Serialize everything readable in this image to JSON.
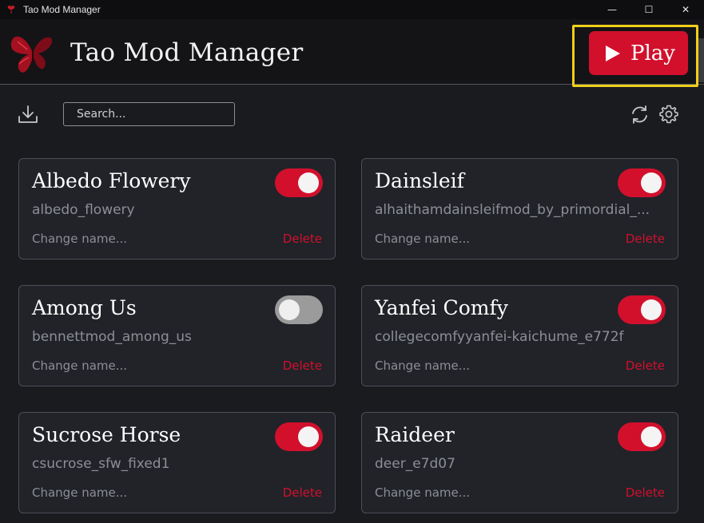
{
  "window": {
    "title": "Tao Mod Manager",
    "controls": {
      "minimize": "—",
      "maximize": "☐",
      "close": "✕"
    }
  },
  "header": {
    "title": "Tao Mod Manager",
    "play_label": "Play"
  },
  "toolbar": {
    "search_placeholder": "Search..."
  },
  "colors": {
    "accent": "#d2102c",
    "background": "#1a1b1f",
    "card": "#212329",
    "highlight": "#f0cf19"
  },
  "icons": {
    "download": "download-icon",
    "refresh": "refresh-icon",
    "settings": "gear-icon",
    "play": "play-icon",
    "logo": "butterfly-logo-icon"
  },
  "mods": [
    {
      "name": "Albedo Flowery",
      "folder": "albedo_flowery",
      "enabled": true,
      "rename_label": "Change name...",
      "delete_label": "Delete"
    },
    {
      "name": "Dainsleif",
      "folder": "alhaithamdainsleifmod_by_primordial_...",
      "enabled": true,
      "rename_label": "Change name...",
      "delete_label": "Delete"
    },
    {
      "name": "Among Us",
      "folder": "bennettmod_among_us",
      "enabled": false,
      "rename_label": "Change name...",
      "delete_label": "Delete"
    },
    {
      "name": "Yanfei Comfy",
      "folder": "collegecomfyyanfei-kaichume_e772f",
      "enabled": true,
      "rename_label": "Change name...",
      "delete_label": "Delete"
    },
    {
      "name": "Sucrose Horse",
      "folder": "csucrose_sfw_fixed1",
      "enabled": true,
      "rename_label": "Change name...",
      "delete_label": "Delete"
    },
    {
      "name": "Raideer",
      "folder": "deer_e7d07",
      "enabled": true,
      "rename_label": "Change name...",
      "delete_label": "Delete"
    }
  ]
}
